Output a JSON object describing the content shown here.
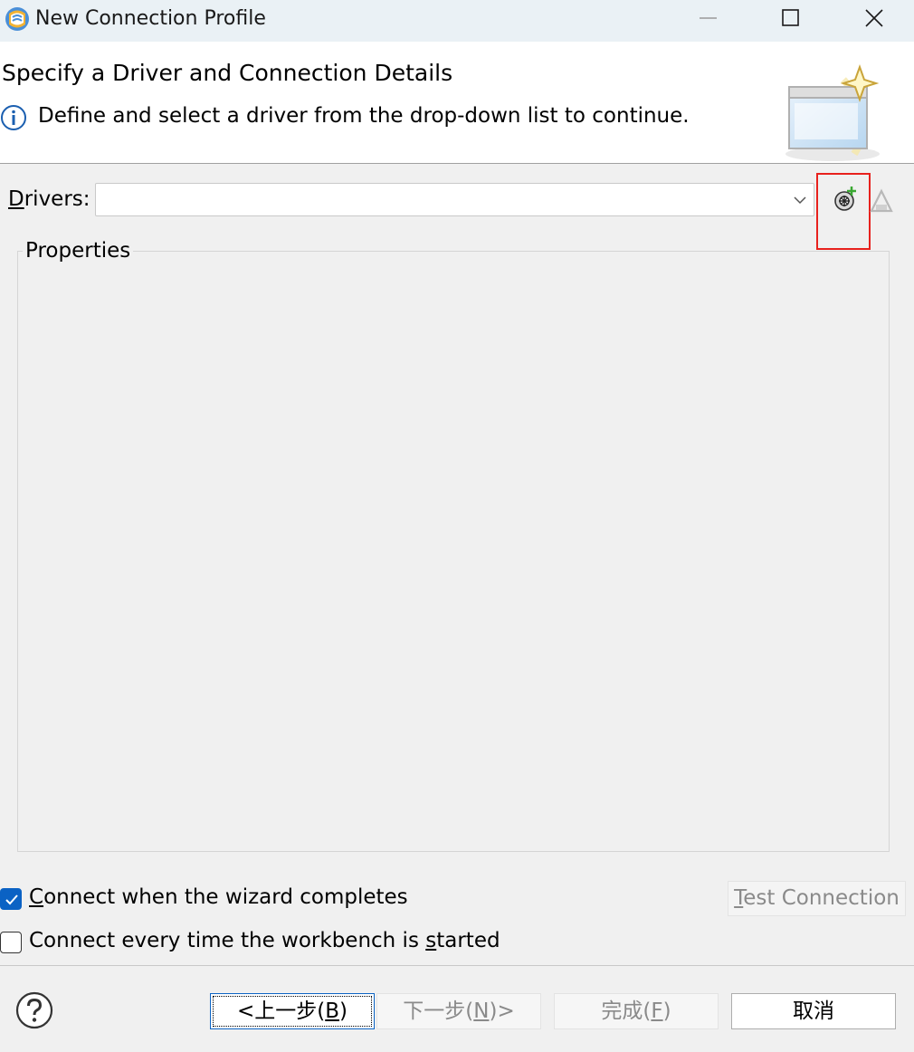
{
  "window": {
    "title": "New Connection Profile",
    "app_icon": "eclipse-database-icon",
    "controls": [
      "minimize-icon",
      "maximize-icon",
      "close-icon"
    ]
  },
  "header": {
    "title": "Specify a Driver and Connection Details",
    "message_icon": "info-icon",
    "message": "Define and select a driver from the drop-down list to continue.",
    "graphic": "wizard-window-sparkle-icon"
  },
  "drivers": {
    "label_mnemonic": "D",
    "label_rest": "rivers:",
    "value": "",
    "new_driver_icon": "new-driver-definition-icon",
    "edit_driver_icon": "edit-driver-definition-icon",
    "highlight_color": "#e8211d"
  },
  "properties": {
    "label": "Properties"
  },
  "options": {
    "connect_on_finish": {
      "mnemonic": "C",
      "rest": "onnect when the wizard completes",
      "checked": true
    },
    "connect_on_startup": {
      "before": "Connect every time the workbench is ",
      "mnemonic": "s",
      "after": "tarted",
      "checked": false
    },
    "test_connection": {
      "mnemonic": "T",
      "rest": "est Connection",
      "enabled": false
    }
  },
  "footer": {
    "help_icon": "help-icon",
    "back": {
      "before": "<上一步(",
      "mnemonic": "B",
      "after": ")"
    },
    "next": {
      "before": "下一步(",
      "mnemonic": "N",
      "after": ")>"
    },
    "finish": {
      "before": "完成(",
      "mnemonic": "F",
      "after": ")"
    },
    "cancel": "取消"
  },
  "colors": {
    "accent": "#0b62c4",
    "titlebar": "#eaf1f5",
    "background": "#f0f0f0"
  }
}
